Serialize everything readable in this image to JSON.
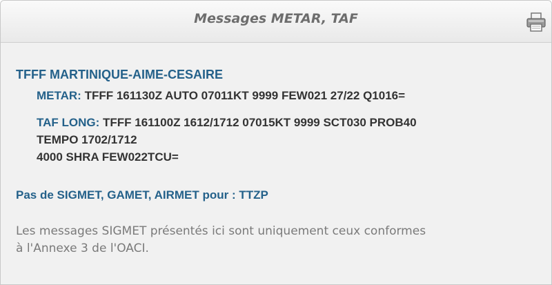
{
  "panel": {
    "title": "Messages METAR, TAF",
    "print_icon": "printer-icon"
  },
  "station": {
    "name": "TFFF MARTINIQUE-AIME-CESAIRE"
  },
  "metar": {
    "label": "METAR:",
    "text": "TFFF 161130Z AUTO 07011KT 9999 FEW021 27/22 Q1016="
  },
  "taf": {
    "label": "TAF LONG:",
    "line1": "TFFF 161100Z 1612/1712 07015KT 9999 SCT030 PROB40",
    "line2": "TEMPO 1702/1712",
    "line3": "4000 SHRA FEW022TCU="
  },
  "sigmet": {
    "text": "Pas de SIGMET, GAMET, AIRMET pour : TTZP"
  },
  "note": {
    "line1": "Les messages SIGMET présentés ici sont uniquement ceux conformes",
    "line2": "à l'Annexe 3 de l'OACI."
  }
}
